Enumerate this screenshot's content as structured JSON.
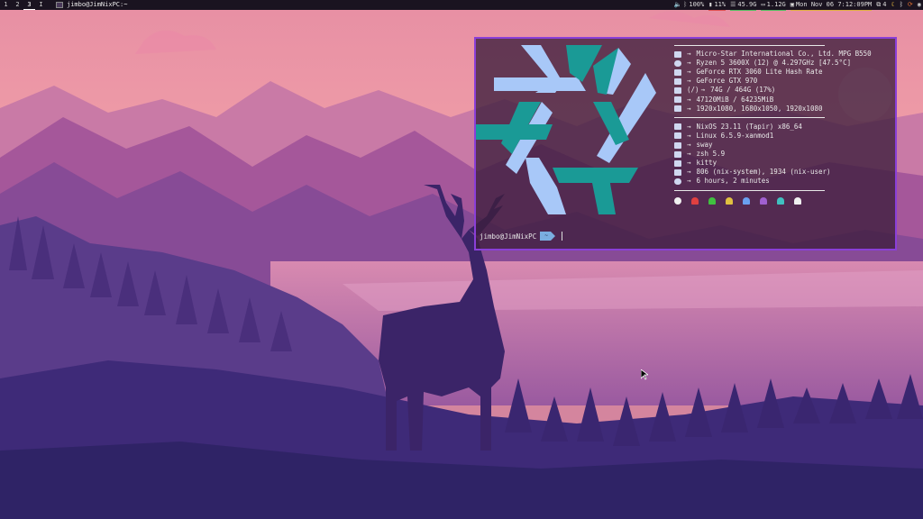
{
  "topbar": {
    "workspaces": [
      "1",
      "2",
      "3",
      "I"
    ],
    "active_workspace": "3",
    "window_title": "jimbo@JimNixPC:~",
    "status": {
      "volume": "100%",
      "brightness": "11%",
      "memory": "45.9G",
      "network": "1.12G",
      "datetime": "Mon Nov 06 7:12:09PM",
      "tray_count": "4"
    }
  },
  "terminal": {
    "info_lines": [
      {
        "icon": "laptop-icon",
        "text": "Micro-Star International Co., Ltd. MPG B550"
      },
      {
        "icon": "cpu-icon",
        "text": "Ryzen 5 3600X (12) @ 4.297GHz [47.5°C]"
      },
      {
        "icon": "gpu-icon",
        "text": "GeForce RTX 3060 Lite Hash Rate"
      },
      {
        "icon": "gpu-icon",
        "text": "GeForce GTX 970"
      },
      {
        "icon": "disk-icon",
        "text": "74G / 464G (17%)"
      },
      {
        "icon": "memory-icon",
        "text": "47120MiB / 64235MiB"
      },
      {
        "icon": "monitor-icon",
        "text": "1920x1080, 1680x1050, 1920x1080"
      }
    ],
    "info_lines_2": [
      {
        "icon": "nixos-icon",
        "text": "NixOS 23.11 (Tapir) x86_64"
      },
      {
        "icon": "linux-icon",
        "text": "Linux 6.5.9-xanmod1"
      },
      {
        "icon": "window-icon",
        "text": "sway"
      },
      {
        "icon": "shell-icon",
        "text": "zsh 5.9"
      },
      {
        "icon": "terminal-icon",
        "text": "kitty"
      },
      {
        "icon": "package-icon",
        "text": "806 (nix-system), 1934 (nix-user)"
      },
      {
        "icon": "clock-icon",
        "text": "6 hours, 2 minutes"
      }
    ],
    "arrow": "→",
    "disk_prefix": "(/)",
    "prompt_user": "jimbo@JimNixPC",
    "prompt_dir": "~",
    "ghost_colors": [
      "#f0f0f0",
      "#e04040",
      "#40c040",
      "#e0c040",
      "#6aa0f0",
      "#a060d0",
      "#40c0c0",
      "#f0f0f0"
    ]
  },
  "colors": {
    "accent_border": "#8a3fd8",
    "logo_light": "#a8c8f8",
    "logo_teal": "#1a9a96"
  }
}
